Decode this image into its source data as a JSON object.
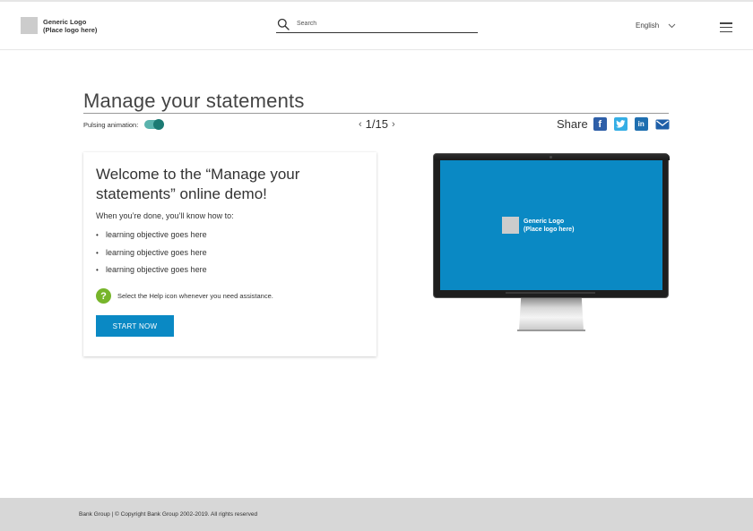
{
  "header": {
    "logo_line1": "Generic Logo",
    "logo_line2": "(Place logo here)",
    "search_placeholder": "Search",
    "language": "English"
  },
  "main": {
    "title": "Manage your statements",
    "pulsing_label": "Pulsing animation:",
    "pulsing_enabled": true,
    "page_current": "1/15",
    "share_label": "Share"
  },
  "card": {
    "title": "Welcome to the “Manage your statements” online demo!",
    "intro": "When you’re done, you’ll know how to:",
    "objectives": [
      "learning objective goes here",
      "learning objective goes here",
      "learning objective goes here"
    ],
    "help_text": "Select the Help icon whenever you need assistance.",
    "start_label": "START NOW"
  },
  "monitor": {
    "logo_line1": "Generic Logo",
    "logo_line2": "(Place logo here)"
  },
  "footer": {
    "text": "Bank Group  |   © Copyright Bank Group 2002-2019. All rights reserved"
  },
  "colors": {
    "accent_blue": "#0a89c4",
    "toggle_teal": "#1b7a73",
    "help_green": "#77b52b",
    "facebook": "#2e5fa8",
    "twitter": "#35aee5",
    "linkedin": "#1f6fb0",
    "footer_bg": "#d7d7d7"
  },
  "icons": [
    "search-icon",
    "chevron-down-icon",
    "hamburger-menu-icon",
    "facebook-icon",
    "twitter-icon",
    "linkedin-icon",
    "mail-icon",
    "help-icon"
  ]
}
